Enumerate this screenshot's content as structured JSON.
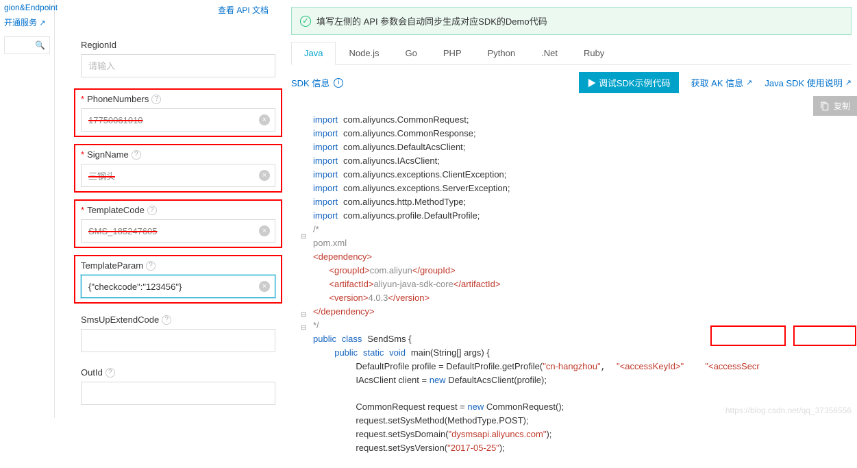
{
  "sidebar": {
    "link1": "gion&Endpoint",
    "link2": "开通服务"
  },
  "api_doc_link": "查看 API 文档",
  "form": {
    "region": {
      "label": "RegionId",
      "placeholder": "请输入"
    },
    "phone": {
      "label": "PhoneNumbers",
      "value": "17750061010"
    },
    "sign": {
      "label": "SignName",
      "value": "三钢头"
    },
    "tcode": {
      "label": "TemplateCode",
      "value": "SMS_185247605"
    },
    "tparam": {
      "label": "TemplateParam",
      "value": "{\"checkcode\":\"123456\"}"
    },
    "smsup": {
      "label": "SmsUpExtendCode"
    },
    "outid": {
      "label": "OutId"
    }
  },
  "right": {
    "banner": "填写左侧的 API 参数会自动同步生成对应SDK的Demo代码",
    "tabs": [
      "Java",
      "Node.js",
      "Go",
      "PHP",
      "Python",
      ".Net",
      "Ruby"
    ],
    "sdk_info": "SDK 信息",
    "debug_btn": "▶ 调试SDK示例代码",
    "ak_link": "获取 AK 信息",
    "sdk_usage": "Java SDK 使用说明",
    "copy_label": "复制"
  },
  "code": {
    "l1": "import",
    "l1b": "com.aliyuncs.CommonRequest;",
    "l2": "import",
    "l2b": "com.aliyuncs.CommonResponse;",
    "l3": "import",
    "l3b": "com.aliyuncs.DefaultAcsClient;",
    "l4": "import",
    "l4b": "com.aliyuncs.IAcsClient;",
    "l5": "import",
    "l5b": "com.aliyuncs.exceptions.ClientException;",
    "l6": "import",
    "l6b": "com.aliyuncs.exceptions.ServerException;",
    "l7": "import",
    "l7b": "com.aliyuncs.http.MethodType;",
    "l8": "import",
    "l8b": "com.aliyuncs.profile.DefaultProfile;",
    "c1": "/*",
    "c2": "pom.xml",
    "dep_open": "<dependency>",
    "gid_o": "<groupId>",
    "gid_v": "com.aliyun",
    "gid_c": "</groupId>",
    "aid_o": "<artifactId>",
    "aid_v": "aliyun-java-sdk-core",
    "aid_c": "</artifactId>",
    "ver_o": "<version>",
    "ver_v": "4.0.3",
    "ver_c": "</version>",
    "dep_close": "</dependency>",
    "c3": "*/",
    "pub": "public",
    "cls": "class",
    "clsname": "SendSms {",
    "pub2": "public",
    "stat": "static",
    "vd": "void",
    "main": "main(String[] args) {",
    "line_a": "DefaultProfile profile = DefaultProfile.getProfile(",
    "s_region": "\"cn-hangzhou\"",
    "s_ak": "\"<accessKeyId>\"",
    "s_as": "\"<accessSecr",
    "line_b1": "IAcsClient client = ",
    "new1": "new",
    "line_b2": " DefaultAcsClient(profile);",
    "line_c1": "CommonRequest request = ",
    "new2": "new",
    "line_c2": " CommonRequest();",
    "line_d": "request.setSysMethod(MethodType.POST);",
    "line_e1": "request.setSysDomain(",
    "s_dom": "\"dysmsapi.aliyuncs.com\"",
    "line_e2": ");",
    "line_f1": "request.setSysVersion(",
    "s_ver": "\"2017-05-25\"",
    "line_f2": ");"
  },
  "watermark": "https://blog.csdn.net/qq_37356556"
}
